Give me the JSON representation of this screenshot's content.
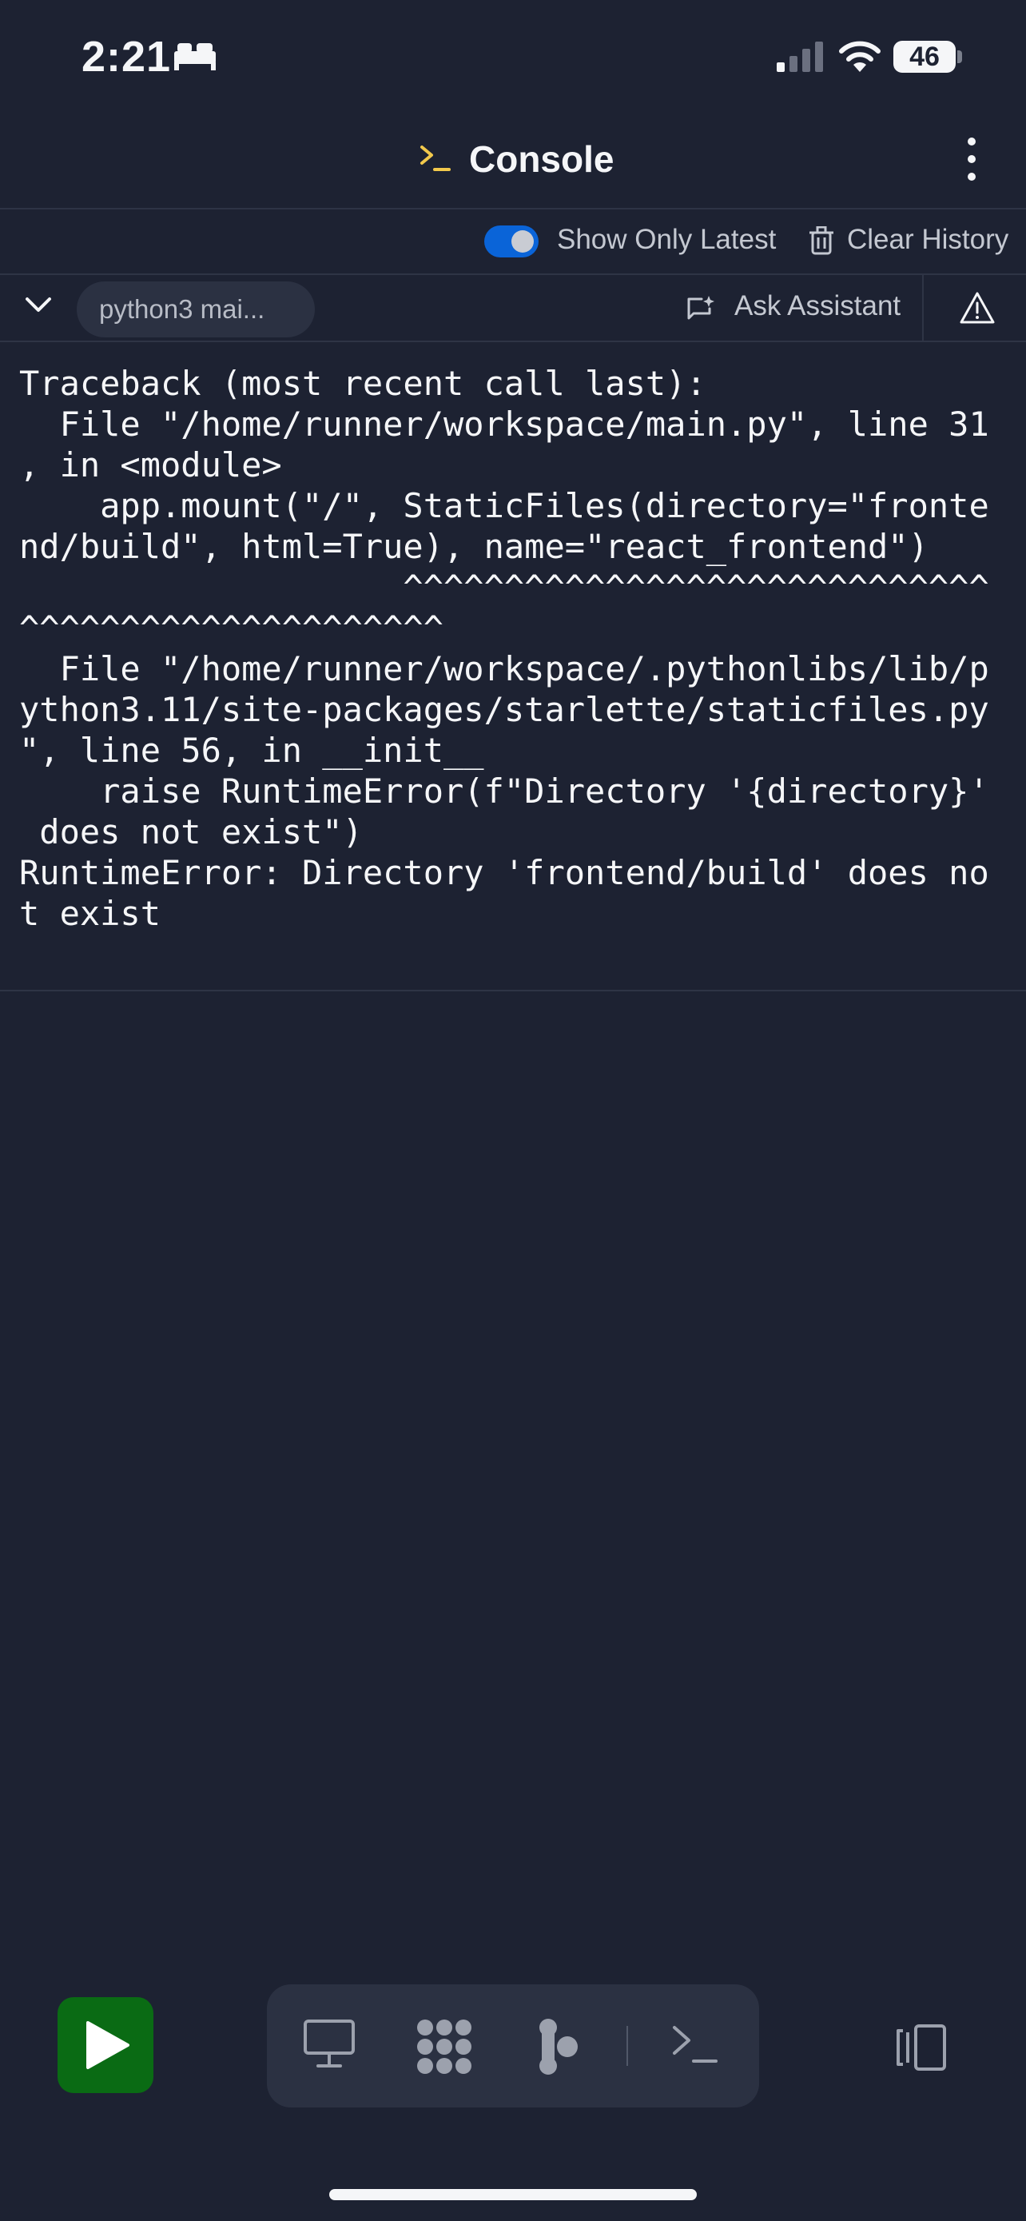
{
  "status_bar": {
    "time": "2:21",
    "battery": "46"
  },
  "header": {
    "title": "Console"
  },
  "toolbar": {
    "toggle_label": "Show Only Latest",
    "clear_history": "Clear History"
  },
  "process": {
    "name": "python3 mai...",
    "ask_assistant": "Ask Assistant"
  },
  "console": {
    "output": "Traceback (most recent call last):\n  File \"/home/runner/workspace/main.py\", line 31\n, in <module>\n    app.mount(\"/\", StaticFiles(directory=\"fronte\nnd/build\", html=True), name=\"react_frontend\")\n                   ^^^^^^^^^^^^^^^^^^^^^^^^^^^^^\n^^^^^^^^^^^^^^^^^^^^^\n  File \"/home/runner/workspace/.pythonlibs/lib/p\nython3.11/site-packages/starlette/staticfiles.py\n\", line 56, in __init__\n    raise RuntimeError(f\"Directory '{directory}'\n does not exist\")\nRuntimeError: Directory 'frontend/build' does no\nt exist"
  },
  "icons": {
    "sleep": "bed-icon",
    "signal": "cellular-signal-icon",
    "wifi": "wifi-icon",
    "console": "terminal-prompt-icon",
    "menu": "more-vertical-icon",
    "trash": "trash-icon",
    "chevron": "chevron-down-icon",
    "ask": "chat-sparkle-icon",
    "warning": "warning-triangle-icon",
    "run": "play-icon",
    "webview": "monitor-icon",
    "workflows": "workflows-icon",
    "agent": "agent-icon",
    "shell": "terminal-prompt-icon",
    "layout": "panel-layout-icon"
  },
  "colors": {
    "background": "#1d2232",
    "toggle_on": "#0a64d8",
    "run_button": "#0a6b14",
    "console_glyph": "#f2c94c"
  }
}
